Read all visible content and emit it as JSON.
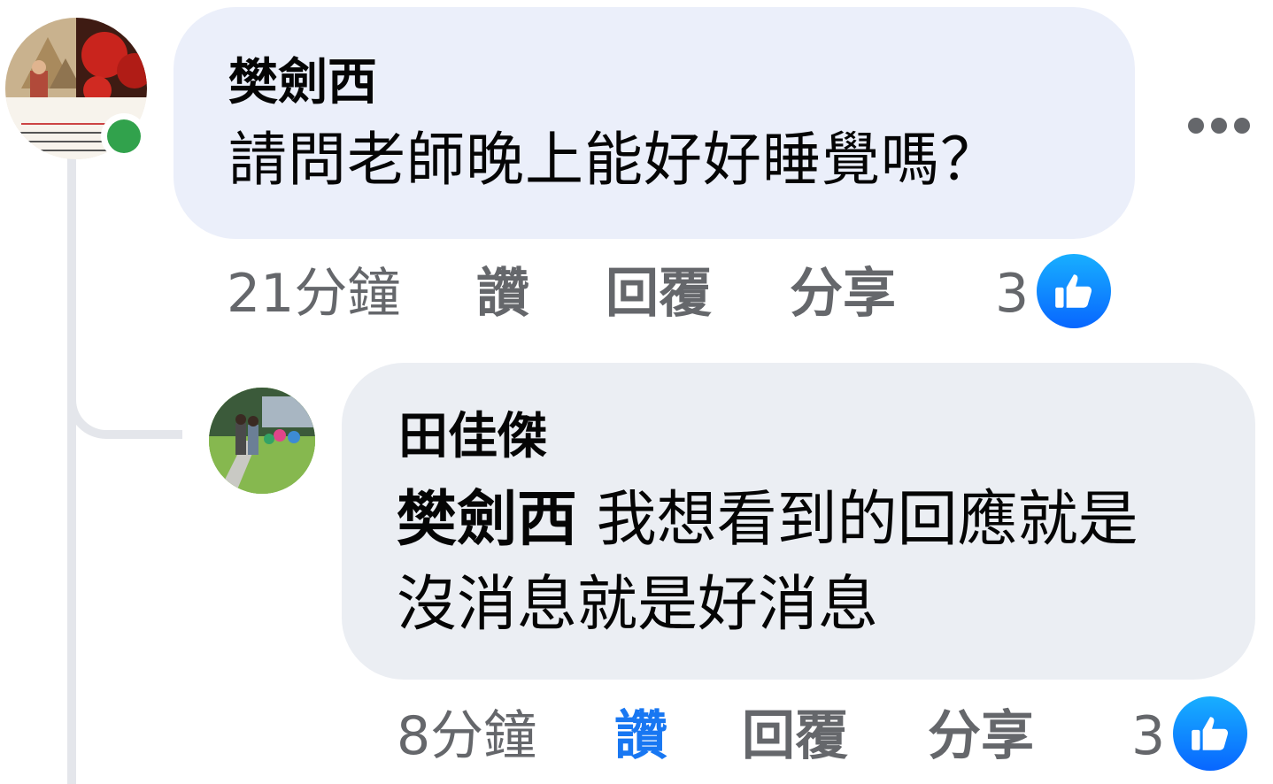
{
  "comment": {
    "author": "樊劍西",
    "text": "請問老師晚上能好好睡覺嗎？",
    "time": "21分鐘",
    "like_label": "讚",
    "reply_label": "回覆",
    "share_label": "分享",
    "reaction_count": "3",
    "liked": false,
    "online": true,
    "avatar_caption": "樊劍西 - 玫瑰"
  },
  "reply": {
    "author": "田佳傑",
    "mention": "樊劍西",
    "text_line1": " 我想看到的回應就是",
    "text_line2": "沒消息就是好消息",
    "time": "8分鐘",
    "like_label": "讚",
    "reply_label": "回覆",
    "share_label": "分享",
    "reaction_count": "3",
    "liked": true
  },
  "icons": {
    "more": "more-horizontal-icon",
    "reaction": "thumbs-up-icon"
  },
  "colors": {
    "link_blue": "#1877f2",
    "secondary_text": "#65676b",
    "online_green": "#31a24c",
    "bubble_bg": "#f0f2f5"
  }
}
